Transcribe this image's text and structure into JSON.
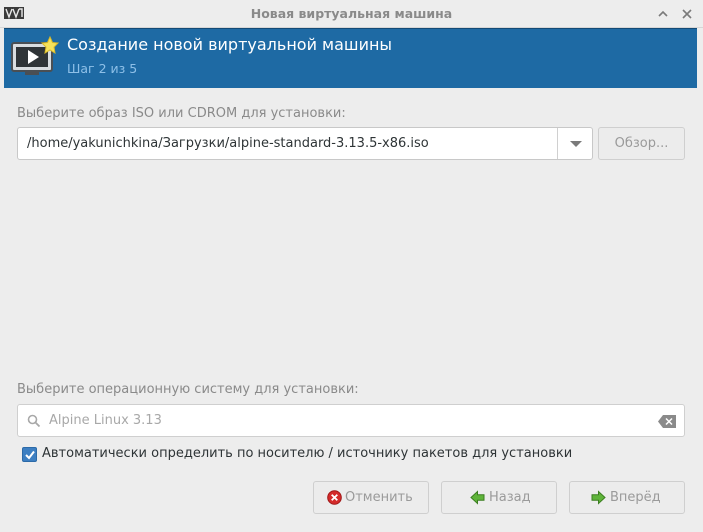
{
  "window": {
    "title": "Новая виртуальная машина"
  },
  "banner": {
    "title": "Создание новой виртуальной машины",
    "step": "Шаг 2 из 5",
    "icon": "vm-create-icon"
  },
  "iso": {
    "label": "Выберите образ ISO или CDROM для установки:",
    "value": "/home/yakunichkina/Загрузки/alpine-standard-3.13.5-x86.iso",
    "browse_label": "Обзор..."
  },
  "os": {
    "label": "Выберите операционную систему для установки:",
    "value": "Alpine Linux 3.13",
    "auto_detect_label": "Автоматически определить по носителю / источнику пакетов для установки",
    "auto_detect_checked": true
  },
  "buttons": {
    "cancel": "Отменить",
    "back": "Назад",
    "next": "Вперёд"
  },
  "colors": {
    "banner": "#1e6aa4",
    "banner_subtitle": "#8ec0e8",
    "checkbox": "#3d7fc2"
  }
}
